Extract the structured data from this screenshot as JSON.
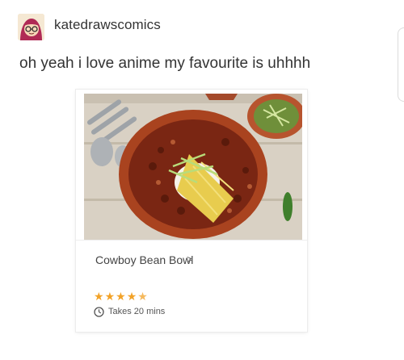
{
  "post": {
    "username": "katedrawscomics",
    "text": "oh yeah i love anime my favourite is uhhhh"
  },
  "recipe_card": {
    "title": "Cowboy Bean Bowl",
    "chevron": ">",
    "rating": 4.5,
    "rating_max": 5,
    "time_text": "Takes 20 mins"
  },
  "icons": {
    "avatar": "avatar-icon",
    "clock": "clock-icon",
    "star": "star-icon"
  },
  "colors": {
    "star": "#f2a227",
    "text": "#333333"
  }
}
